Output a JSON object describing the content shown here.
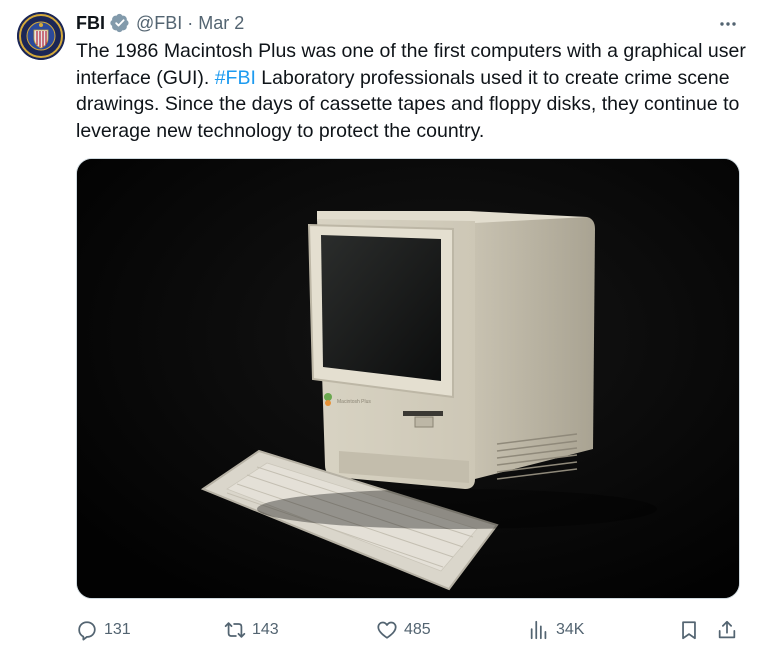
{
  "author": {
    "name": "FBI",
    "handle": "@FBI",
    "separator": "·",
    "date": "Mar 2"
  },
  "tweet": {
    "text_before": "The 1986 Macintosh Plus was one of the first computers with a graphical user interface (GUI). ",
    "hashtag": "#FBI",
    "text_after": " Laboratory professionals used it to create crime scene drawings. Since the days of cassette tapes and floppy disks, they continue to leverage new technology to protect the country."
  },
  "media": {
    "logo_text": "Macintosh Plus"
  },
  "actions": {
    "replies": "131",
    "reposts": "143",
    "likes": "485",
    "views": "34K"
  },
  "icons": {
    "reply": "reply-icon",
    "repost": "repost-icon",
    "like": "heart-icon",
    "views": "views-icon",
    "bookmark": "bookmark-icon",
    "share": "share-icon",
    "more": "more-icon",
    "verified": "verified-badge-icon"
  },
  "colors": {
    "accent": "#1d9bf0",
    "secondary_text": "#536471",
    "primary_text": "#0f1419",
    "verified_badge": "#829aab"
  }
}
